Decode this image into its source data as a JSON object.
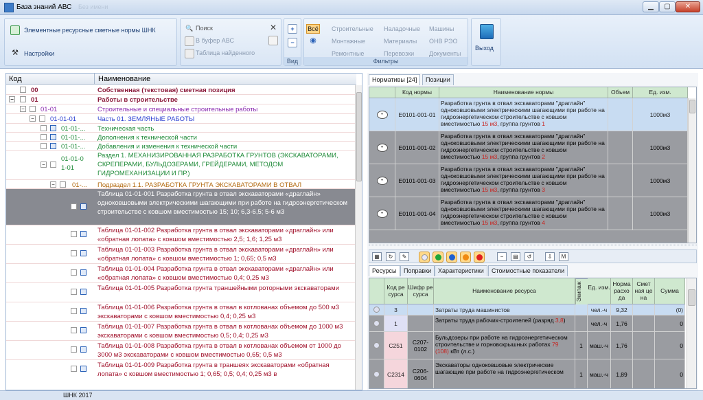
{
  "window": {
    "title": "База знаний АВС",
    "ghost_title": "Без имени",
    "min": "▁",
    "max": "▢",
    "close": "✕"
  },
  "ribbon": {
    "nav": {
      "norms_label": "Элементные ресурсные сметные нормы ШНК",
      "settings_label": "Настройки"
    },
    "search": {
      "search_label": "Поиск",
      "buffer_label": "В буфер АВС",
      "found_label": "Таблица найденного"
    },
    "view": {
      "caption": "Вид",
      "all_label": "Всё"
    },
    "filters": {
      "caption": "Фильтры",
      "items": [
        "Строительные",
        "Наладочные",
        "Машины",
        "Монтажные",
        "Материалы",
        "ОНВ РЭО",
        "Ремонтные",
        "Перевозки",
        "Документы"
      ]
    },
    "exit_label": "Выход"
  },
  "tree": {
    "headers": {
      "code": "Код",
      "name": "Наименование"
    },
    "rows": [
      {
        "code": "00",
        "name": "Собственная (текстовая) сметная позиция",
        "color": "#8b1a3a"
      },
      {
        "code": "01",
        "name": "Работы в строительстве",
        "color": "#8b1a3a"
      },
      {
        "code": "01-01",
        "name": "Строительные и специальные строительные работы",
        "color": "#8b2bb0"
      },
      {
        "code": "01-01-01",
        "name": "Часть 01. ЗЕМЛЯНЫЕ РАБОТЫ",
        "color": "#2c3fd0"
      },
      {
        "code": "01-01-...",
        "name": "Техническая часть",
        "color": "#1f8a38"
      },
      {
        "code": "01-01-...",
        "name": "Дополнения к технической части",
        "color": "#1f8a38"
      },
      {
        "code": "01-01-...",
        "name": "Добавления и изменения к технической части",
        "color": "#1f8a38"
      },
      {
        "code_line1": "01-01-0",
        "code_line2": "1-01",
        "name": "Раздел 1. МЕХАНИЗИРОВАННАЯ РАЗРАБОТКА ГРУНТОВ (ЭКСКАВАТОРАМИ, СКРЕПЕРАМИ, БУЛЬДОЗЕРАМИ, ГРЕЙДЕРАМИ, МЕТОДОМ ГИДРОМЕХАНИЗАЦИИ И ПР.)",
        "color": "#1f8a38"
      },
      {
        "code": "01-...",
        "name": "Подраздел 1.1. РАЗРАБОТКА ГРУНТА ЭКСКАВАТОРАМИ В ОТВАЛ",
        "color": "#b36a10"
      },
      {
        "name": "Таблица 01-01-001 Разработка грунта в отвал экскаваторами «драглайн» одноковшовыми электрическими шагающими при работе на гидроэнергетическом строительстве с ковшом вместимостью 15; 10; 6,3-6,5; 5-6 м3",
        "color": "#a0102a"
      },
      {
        "name": "Таблица 01-01-002 Разработка грунта в отвал экскаваторами «драглайн» или «обратная лопата» с ковшом вместимостью 2,5; 1,6; 1,25 м3",
        "color": "#a0102a"
      },
      {
        "name": "Таблица 01-01-003 Разработка грунта в отвал экскаваторами «драглайн» или «обратная лопата» с ковшом вместимостью 1; 0,65; 0,5 м3",
        "color": "#a0102a"
      },
      {
        "name": "Таблица 01-01-004 Разработка грунта в отвал экскаваторами «драглайн» или «обратная лопата» с ковшом вместимостью 0,4; 0,25 м3",
        "color": "#a0102a"
      },
      {
        "name": "Таблица 01-01-005 Разработка грунта траншейными роторными экскаваторами",
        "color": "#a0102a"
      },
      {
        "name": "Таблица 01-01-006 Разработка грунта в отвал в котлованах объемом до 500 м3 экскаваторами с ковшом вместимостью 0,4; 0,25 м3",
        "color": "#a0102a"
      },
      {
        "name": "Таблица 01-01-007 Разработка грунта в отвал в котлованах объемом до 1000 м3 экскаваторами с ковшом вместимостью 0,5; 0,4; 0,25 м3",
        "color": "#a0102a"
      },
      {
        "name": "Таблица 01-01-008 Разработка грунта в отвал в котлованах объемом от 1000 до 3000 м3 экскаваторами с ковшом вместимостью 0,65; 0,5 м3",
        "color": "#a0102a"
      },
      {
        "name": "Таблица 01-01-009 Разработка грунта в траншеях экскаваторами «обратная лопата» с ковшом вместимостью 1; 0,65; 0,5; 0,4; 0,25 м3 в",
        "color": "#a0102a"
      }
    ]
  },
  "norms": {
    "tabs": [
      "Нормативы [24]",
      "Позиции"
    ],
    "headers": {
      "code": "Код нормы",
      "name": "Наименование нормы",
      "volume": "Объем",
      "unit": "Ед. изм."
    },
    "name_prefix": "Разработка грунта в отвал экскаваторами \"драглайн\" одноковшовыми электрическими шагающими при работе на гидроэнергетическом строительстве с ковшом вместимостью",
    "qty": "15 м3",
    "group_label": ", группа грунтов",
    "rows": [
      {
        "code": "E0101-001-01",
        "group": "1",
        "unit": "1000м3"
      },
      {
        "code": "E0101-001-02",
        "group": "2",
        "unit": "1000м3"
      },
      {
        "code": "E0101-001-03",
        "group": "3",
        "unit": "1000м3"
      },
      {
        "code": "E0101-001-04",
        "group": "4",
        "unit": "1000м3"
      }
    ]
  },
  "resources": {
    "tabs": [
      "Ресурсы",
      "Поправки",
      "Характеристики",
      "Стоимостные показатели"
    ],
    "toolbar_icons": [
      "filter-icon",
      "refresh-icon",
      "dot-white",
      "dot-green",
      "dot-blue",
      "dot-orange",
      "dot-red",
      "minus-icon",
      "table-icon",
      "undo-icon",
      "export-icon",
      "m-icon"
    ],
    "toolbar_m": "M",
    "headers": {
      "code": "Код ре сурса",
      "cipher": "Шифр ре сурса",
      "name": "Наименование ресурса",
      "crew": "Экипаж",
      "unit": "Ед. изм.",
      "norm": "Норма расхо да",
      "price": "Смет ная це на",
      "sum": "Сумма"
    },
    "rows": [
      {
        "code": "3",
        "cipher": "",
        "name": "Затраты труда машинистов",
        "crew": "",
        "unit": "чел.-ч",
        "norm": "9,32",
        "price": "",
        "sum": "(0)"
      },
      {
        "code": "1",
        "cipher": "",
        "name": "Затраты труда рабочих-строителей (разряд ",
        "name_red": "3,8",
        "name_tail": ")",
        "crew": "",
        "unit": "чел.-ч",
        "norm": "1,76",
        "price": "",
        "sum": "0"
      },
      {
        "code": "С251",
        "cipher": "С207-0102",
        "name": "Бульдозеры при работе на гидроэнергетическом строительстве и горновскрышных работах ",
        "name_red": "79 (108)",
        "name_tail": " кВт (л.с.)",
        "crew": "1",
        "unit": "маш.-ч",
        "norm": "1,76",
        "price": "",
        "sum": "0"
      },
      {
        "code": "С2314",
        "cipher": "С206-0604",
        "name": "Экскаваторы одноковшовые электрические шагающие при работе на гидроэнергетическом",
        "name_red": "",
        "name_tail": "",
        "crew": "1",
        "unit": "маш.-ч",
        "norm": "1,89",
        "price": "",
        "sum": "0"
      }
    ]
  },
  "status": {
    "text": "ШНК 2017"
  },
  "colors": {
    "selected_row": "#888a91",
    "grid_header": "#cfe8cf",
    "accent": "#3d7bc7"
  }
}
